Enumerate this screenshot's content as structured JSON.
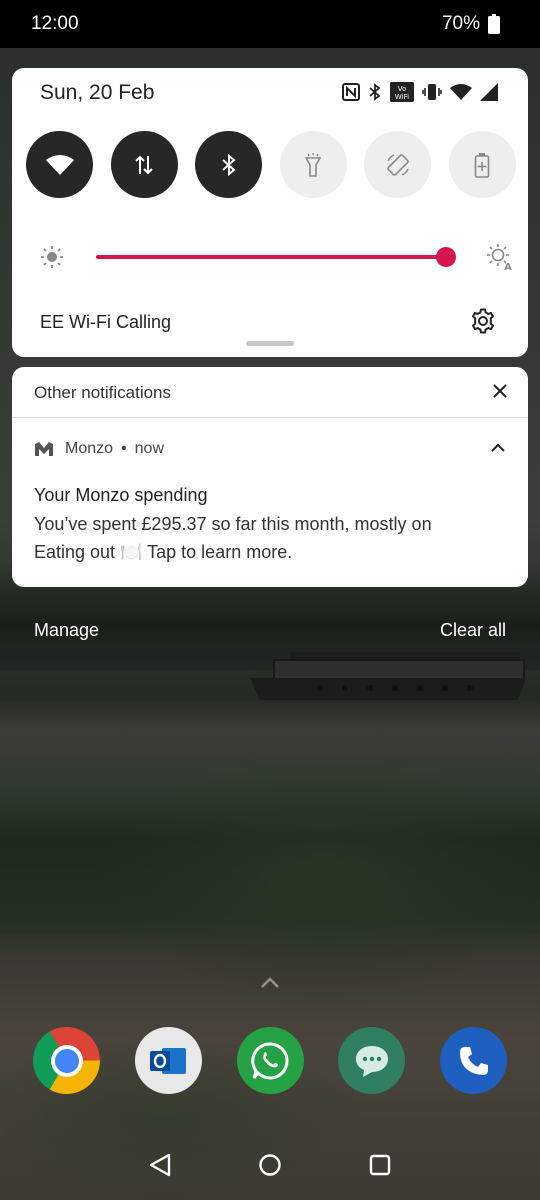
{
  "status_bar": {
    "time": "12:00",
    "battery": "70%"
  },
  "quick_settings": {
    "date": "Sun, 20 Feb",
    "tiles": [
      {
        "name": "wifi",
        "icon": "wifi-icon",
        "state": "on"
      },
      {
        "name": "mobile-data",
        "icon": "data-arrows-icon",
        "state": "on"
      },
      {
        "name": "bluetooth",
        "icon": "bluetooth-icon",
        "state": "on"
      },
      {
        "name": "flashlight",
        "icon": "flashlight-icon",
        "state": "off"
      },
      {
        "name": "auto-rotate",
        "icon": "rotate-icon",
        "state": "off"
      },
      {
        "name": "battery-saver",
        "icon": "battery-saver-icon",
        "state": "off"
      }
    ],
    "brightness_level": 1.0,
    "wifi_calling": "EE Wi-Fi Calling"
  },
  "notifications": {
    "header": "Other notifications",
    "app_name": "Monzo",
    "time": "now",
    "title": "Your Monzo spending",
    "body_line1": "You’ve spent £295.37 so far this month, mostly on",
    "body_line2": "Eating out 🍽️ Tap to learn more."
  },
  "actions": {
    "manage": "Manage",
    "clear_all": "Clear all"
  },
  "colors": {
    "accent": "#d6174d",
    "tile_on": "#272727",
    "tile_off": "#eeeeee"
  }
}
